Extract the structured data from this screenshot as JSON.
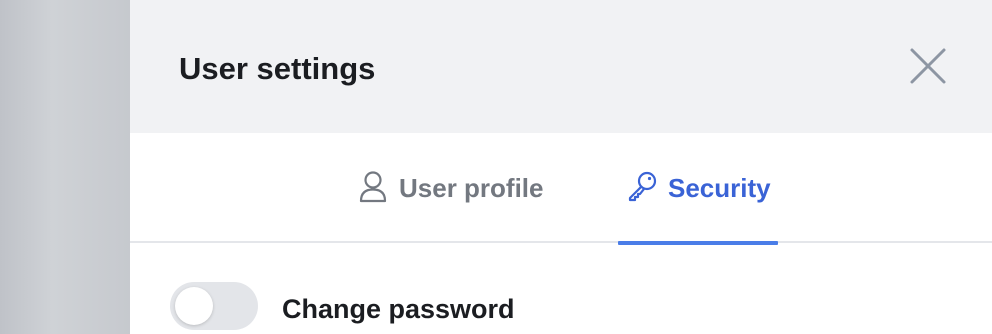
{
  "dialog": {
    "title": "User settings",
    "close_icon": "close-icon"
  },
  "tabs": [
    {
      "label": "User profile",
      "icon": "user-icon",
      "active": false
    },
    {
      "label": "Security",
      "icon": "key-icon",
      "active": true
    }
  ],
  "settings": {
    "change_password": {
      "label": "Change password",
      "enabled": false
    }
  },
  "colors": {
    "accent": "#4a7de8",
    "accent_text": "#3a63d6",
    "inactive_tab_text": "#737880",
    "header_bg": "#f1f2f4",
    "toggle_off_bg": "#e3e5e9"
  }
}
